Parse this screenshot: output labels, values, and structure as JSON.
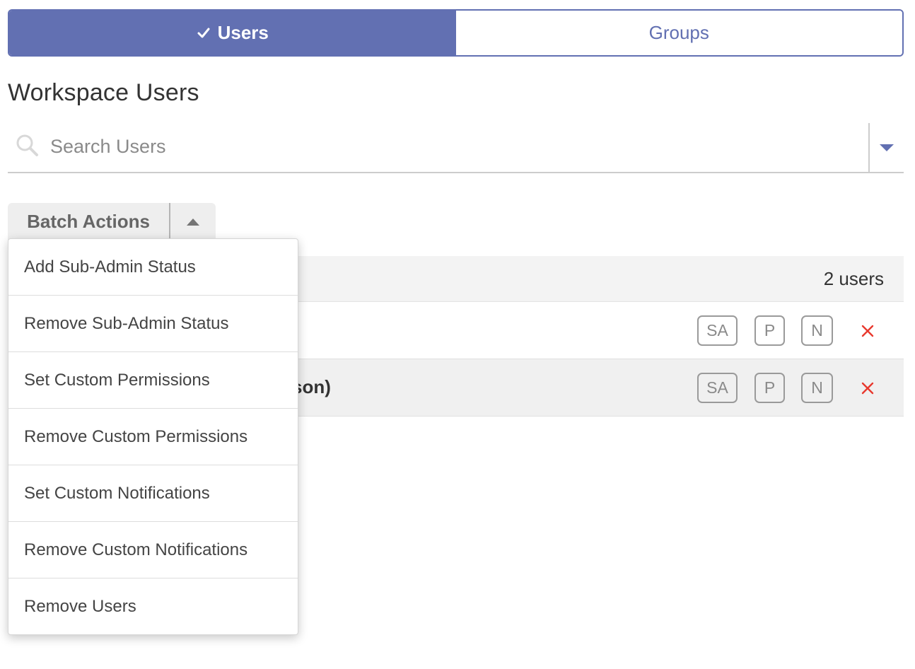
{
  "tabs": [
    {
      "label": "Users",
      "active": true
    },
    {
      "label": "Groups",
      "active": false
    }
  ],
  "heading": "Workspace Users",
  "search": {
    "placeholder": "Search Users",
    "value": ""
  },
  "batch_actions": {
    "label": "Batch Actions",
    "menu": [
      "Add Sub-Admin Status",
      "Remove Sub-Admin Status",
      "Set Custom Permissions",
      "Remove Custom Permissions",
      "Set Custom Notifications",
      "Remove Custom Notifications",
      "Remove Users"
    ]
  },
  "user_list": {
    "count_label": "2 users",
    "rows": [
      {
        "name_partial": ")",
        "badges": [
          "SA",
          "P",
          "N"
        ]
      },
      {
        "name_partial": "son)",
        "badges": [
          "SA",
          "P",
          "N"
        ]
      }
    ]
  },
  "colors": {
    "accent": "#6270b2",
    "remove": "#e8392e"
  },
  "icons": {
    "tab_check": "check-icon",
    "search": "search-icon",
    "filter": "caret-down-icon",
    "batch_toggle": "caret-up-icon",
    "remove": "close-icon"
  }
}
